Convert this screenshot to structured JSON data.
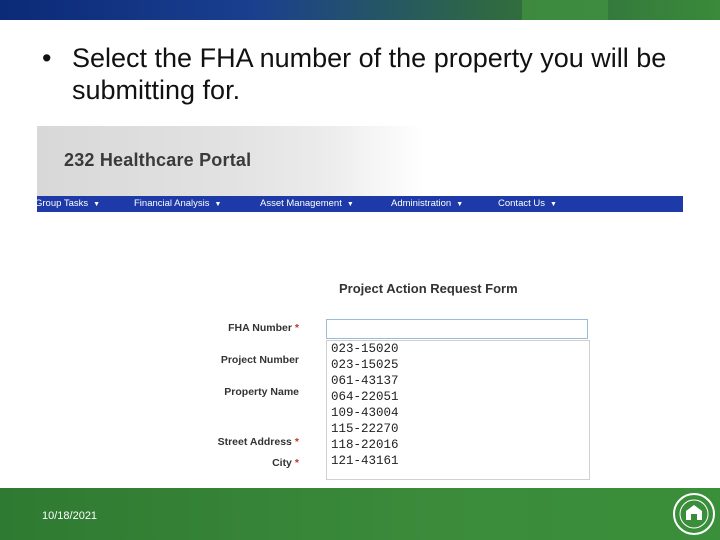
{
  "slide": {
    "bullet_dot": "•",
    "bullet_text": "Select the FHA number of the property you will be submitting for.",
    "date": "10/18/2021"
  },
  "portal": {
    "title": "232 Healthcare Portal",
    "nav": [
      {
        "label": "Group Tasks"
      },
      {
        "label": "Financial Analysis"
      },
      {
        "label": "Asset Management"
      },
      {
        "label": "Administration"
      },
      {
        "label": "Contact Us"
      }
    ],
    "caret": "▼"
  },
  "form": {
    "title": "Project Action Request Form",
    "labels": {
      "fha_number": "FHA Number",
      "project_number": "Project Number",
      "property_name": "Property Name",
      "street_address": "Street Address",
      "city": "City"
    },
    "required_mark": "*",
    "fha_input_value": "",
    "fha_options": [
      "023-15020",
      "023-15025",
      "061-43137",
      "064-22051",
      "109-43004",
      "115-22270",
      "118-22016",
      "121-43161"
    ]
  },
  "colors": {
    "nav_bg": "#1e3aa8",
    "footer_bg": "#3b8b3b",
    "required": "#c0392b"
  }
}
